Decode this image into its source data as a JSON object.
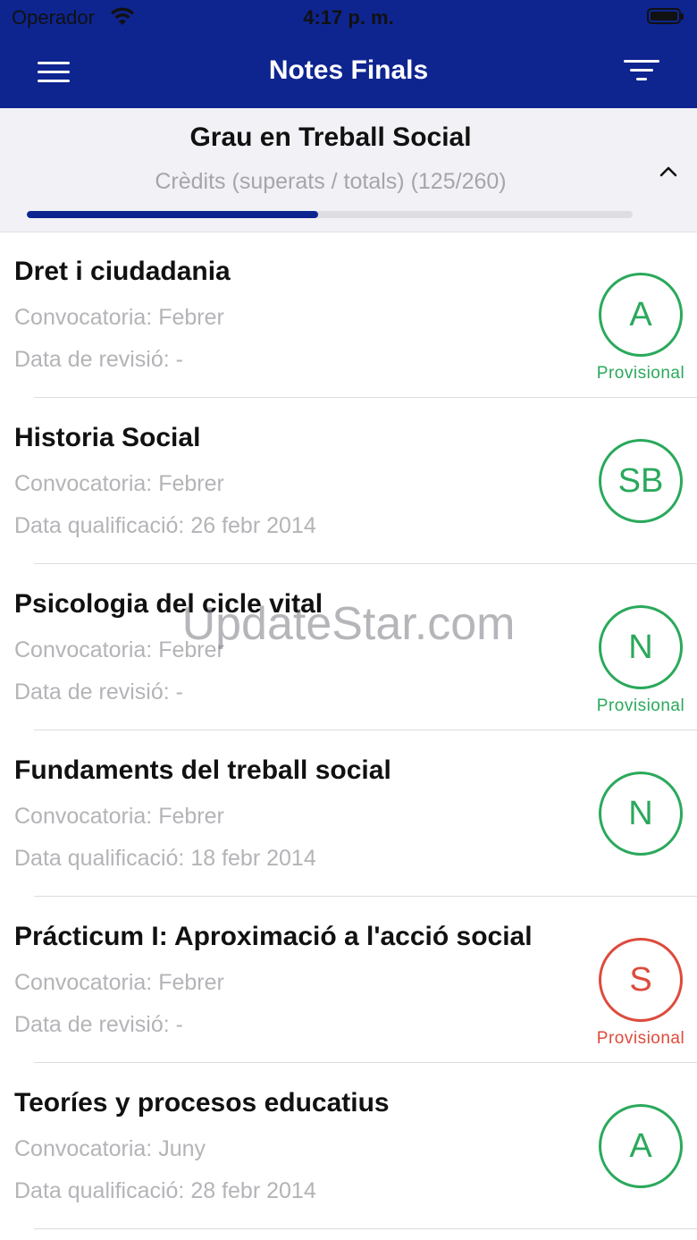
{
  "status_bar": {
    "carrier": "Operador",
    "time": "4:17 p. m.",
    "wifi_icon": "wifi-icon",
    "battery_icon": "battery-icon"
  },
  "nav": {
    "title": "Notes Finals",
    "menu_icon": "hamburger-menu-icon",
    "filter_icon": "filter-icon"
  },
  "summary": {
    "degree": "Grau en Treball Social",
    "credits_label": "Crèdits (superats / totals) (125/260)",
    "credits_passed": 125,
    "credits_total": 260,
    "progress_color": "#0e2590",
    "collapse_icon": "chevron-up-icon"
  },
  "colors": {
    "primary": "#0e2590",
    "pass": "#2aa95b",
    "fail": "#dd4b3c"
  },
  "subjects": [
    {
      "title": "Dret i ciudadania",
      "line1": "Convocatoria: Febrer",
      "line2": "Data de revisió: -",
      "grade": "A",
      "status": "Provisional",
      "fail": false
    },
    {
      "title": "Historia Social",
      "line1": "Convocatoria: Febrer",
      "line2": "Data qualificació: 26 febr 2014",
      "grade": "SB",
      "status": "",
      "fail": false
    },
    {
      "title": "Psicologia del cicle vital",
      "line1": "Convocatoria: Febrer",
      "line2": "Data de revisió: -",
      "grade": "N",
      "status": "Provisional",
      "fail": false
    },
    {
      "title": "Fundaments del treball social",
      "line1": "Convocatoria: Febrer",
      "line2": "Data qualificació: 18 febr 2014",
      "grade": "N",
      "status": "",
      "fail": false
    },
    {
      "title": "Prácticum I: Aproximació a l'acció social",
      "line1": "Convocatoria: Febrer",
      "line2": "Data de revisió: -",
      "grade": "S",
      "status": "Provisional",
      "fail": true
    },
    {
      "title": "Teoríes y procesos educatius",
      "line1": "Convocatoria: Juny",
      "line2": "Data qualificació: 28 febr 2014",
      "grade": "A",
      "status": "",
      "fail": false
    }
  ],
  "watermark": "UpdateStar.com"
}
